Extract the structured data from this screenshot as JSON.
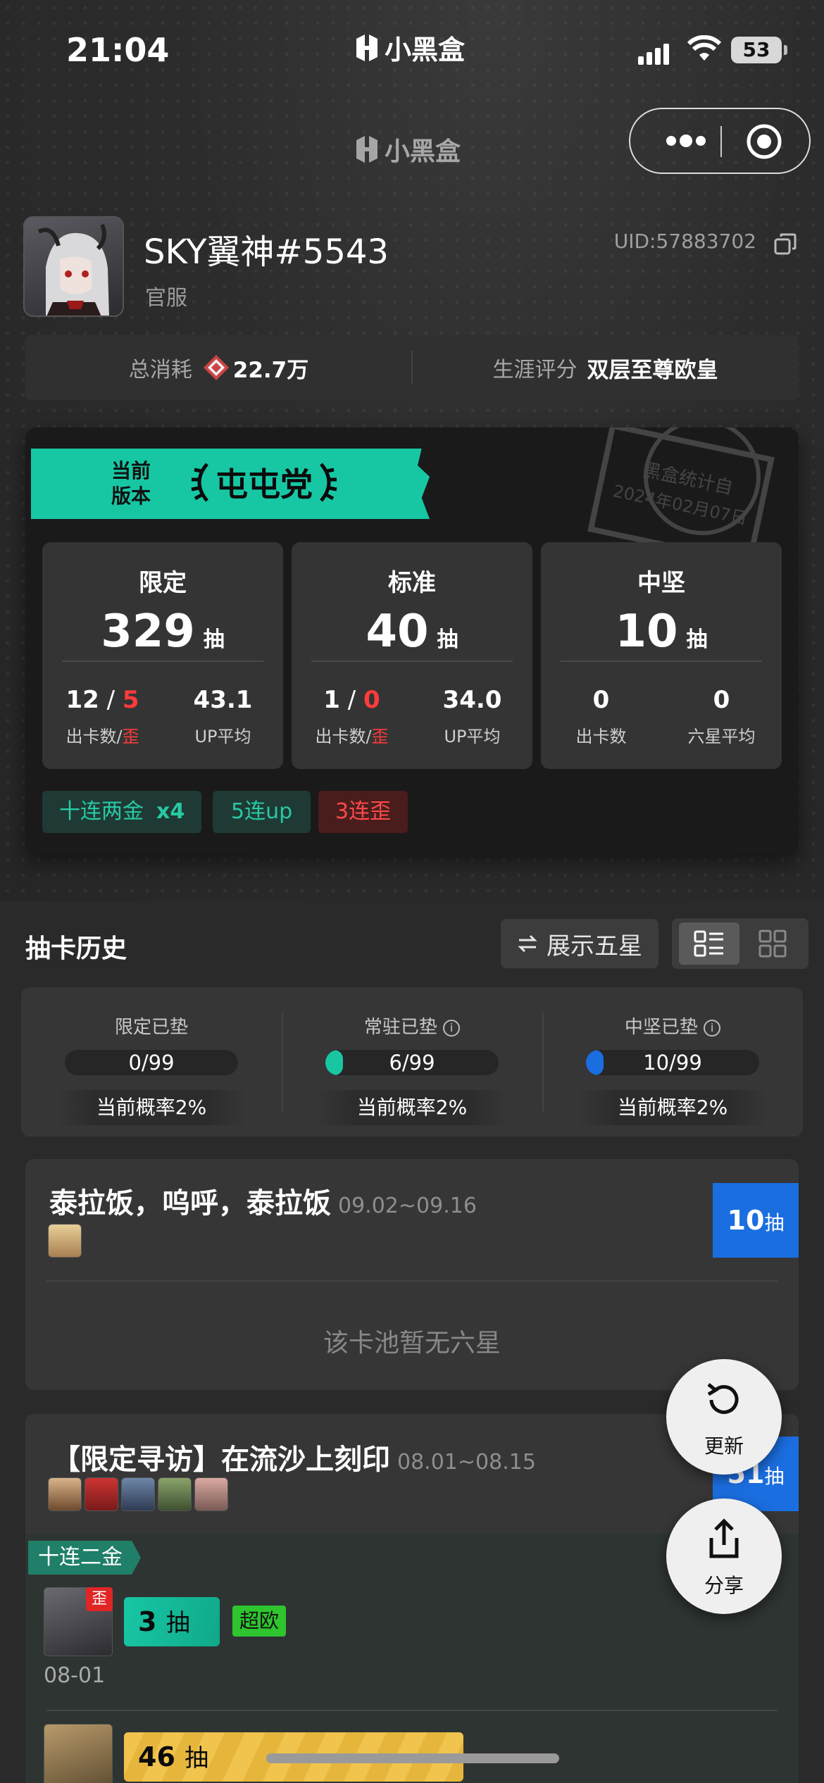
{
  "status_bar": {
    "time": "21:04",
    "battery": "53",
    "icons": [
      "signal-icon",
      "wifi-icon",
      "battery-icon"
    ]
  },
  "brand": {
    "name": "小黑盒"
  },
  "nav": {
    "title": "小黑盒",
    "capsule_icons": [
      "more-icon",
      "record-icon"
    ]
  },
  "profile": {
    "username": "SKY翼神#5543",
    "server": "官服",
    "uid": "UID:57883702",
    "total_spend_label": "总消耗",
    "total_spend_value": "22.7万",
    "career_label": "生涯评分",
    "career_value": "双层至尊欧皇"
  },
  "summary": {
    "badge_line1": "当前",
    "badge_line2": "版本",
    "tier": "屯屯党",
    "stamp_line1": "黑盒统计自",
    "stamp_line2": "2024年02月07日",
    "cards": [
      {
        "title": "限定",
        "count": "329",
        "unit": "抽",
        "left_value_a": "12",
        "left_value_sep": " / ",
        "left_value_b": "5",
        "left_label_a": "出卡数",
        "left_label_sep": "/",
        "left_label_b": "歪",
        "right_value": "43.1",
        "right_label": "UP平均"
      },
      {
        "title": "标准",
        "count": "40",
        "unit": "抽",
        "left_value_a": "1",
        "left_value_sep": " / ",
        "left_value_b": "0",
        "left_label_a": "出卡数",
        "left_label_sep": "/",
        "left_label_b": "歪",
        "right_value": "34.0",
        "right_label": "UP平均"
      },
      {
        "title": "中坚",
        "count": "10",
        "unit": "抽",
        "left_value_a": "0",
        "left_label_a": "出卡数",
        "right_value": "0",
        "right_label": "六星平均"
      }
    ],
    "tags": [
      {
        "text": "十连两金",
        "suffix": "x4"
      },
      {
        "text": "5连up"
      },
      {
        "text": "3连歪"
      }
    ],
    "colors": {
      "accent": "#17c7a4",
      "red": "#ff3b3b",
      "blue": "#1b6ee0"
    }
  },
  "history": {
    "title": "抽卡历史",
    "show_five_label": "展示五星",
    "view_modes": [
      "list-view-icon",
      "grid-view-icon"
    ],
    "pity": [
      {
        "label": "限定已垫",
        "value": "0/99",
        "fraction": 0.0,
        "rate": "当前概率2%",
        "info": false
      },
      {
        "label": "常驻已垫",
        "value": "6/99",
        "fraction": 0.06,
        "rate": "当前概率2%",
        "info": true
      },
      {
        "label": "中坚已垫",
        "value": "10/99",
        "fraction": 0.1,
        "rate": "当前概率2%",
        "info": true
      }
    ],
    "pools": [
      {
        "name": "泰拉饭，呜呼，泰拉饭",
        "date": "09.02~09.16",
        "count": "10",
        "unit": "抽",
        "empty_text": "该卡池暂无六星"
      },
      {
        "name": "【限定寻访】在流沙上刻印",
        "date": "08.01~08.15",
        "count": "51",
        "unit": "抽",
        "group_label": "十连二金",
        "records": [
          {
            "pulls": "3",
            "unit": "抽",
            "badge": "超欧",
            "date": "08-01",
            "off_banner": "歪"
          },
          {
            "pulls": "46",
            "unit": "抽"
          }
        ]
      }
    ]
  },
  "fabs": {
    "refresh": "更新",
    "share": "分享"
  }
}
